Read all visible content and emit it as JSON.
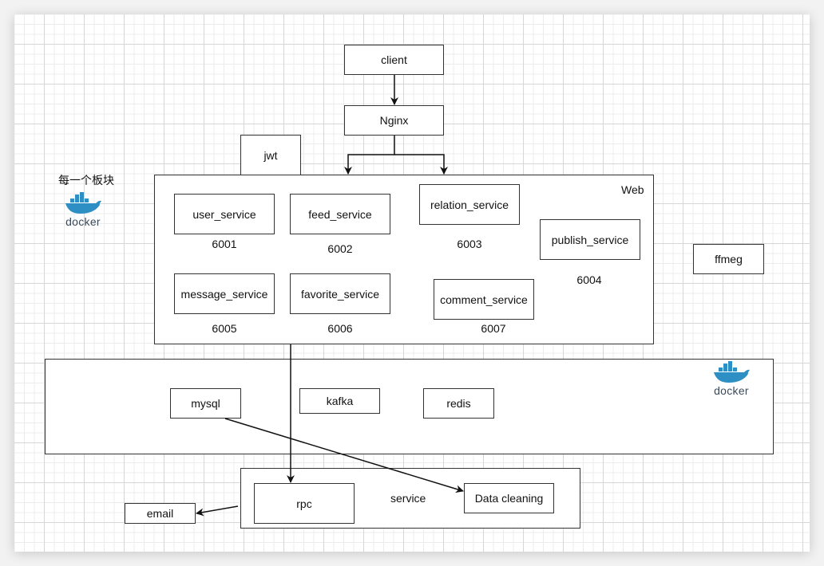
{
  "nodes": {
    "client": "client",
    "nginx": "Nginx",
    "jwt": "jwt",
    "ffmeg": "ffmeg",
    "email": "email"
  },
  "web": {
    "title": "Web",
    "services": [
      {
        "name": "user_service",
        "port": "6001"
      },
      {
        "name": "feed_service",
        "port": "6002"
      },
      {
        "name": "relation_service",
        "port": "6003"
      },
      {
        "name": "publish_service",
        "port": "6004"
      },
      {
        "name": "message_service",
        "port": "6005"
      },
      {
        "name": "favorite_service",
        "port": "6006"
      },
      {
        "name": "comment_service",
        "port": "6007"
      }
    ]
  },
  "infra": {
    "items": [
      "mysql",
      "kafka",
      "redis"
    ],
    "logo_text": "docker"
  },
  "service_group": {
    "title": "service",
    "rpc": "rpc",
    "data_cleaning": "Data cleaning"
  },
  "legend": {
    "note": "每一个板块",
    "logo_text": "docker"
  },
  "colors": {
    "docker_blue": "#2e8fc4",
    "stroke": "#333333"
  }
}
